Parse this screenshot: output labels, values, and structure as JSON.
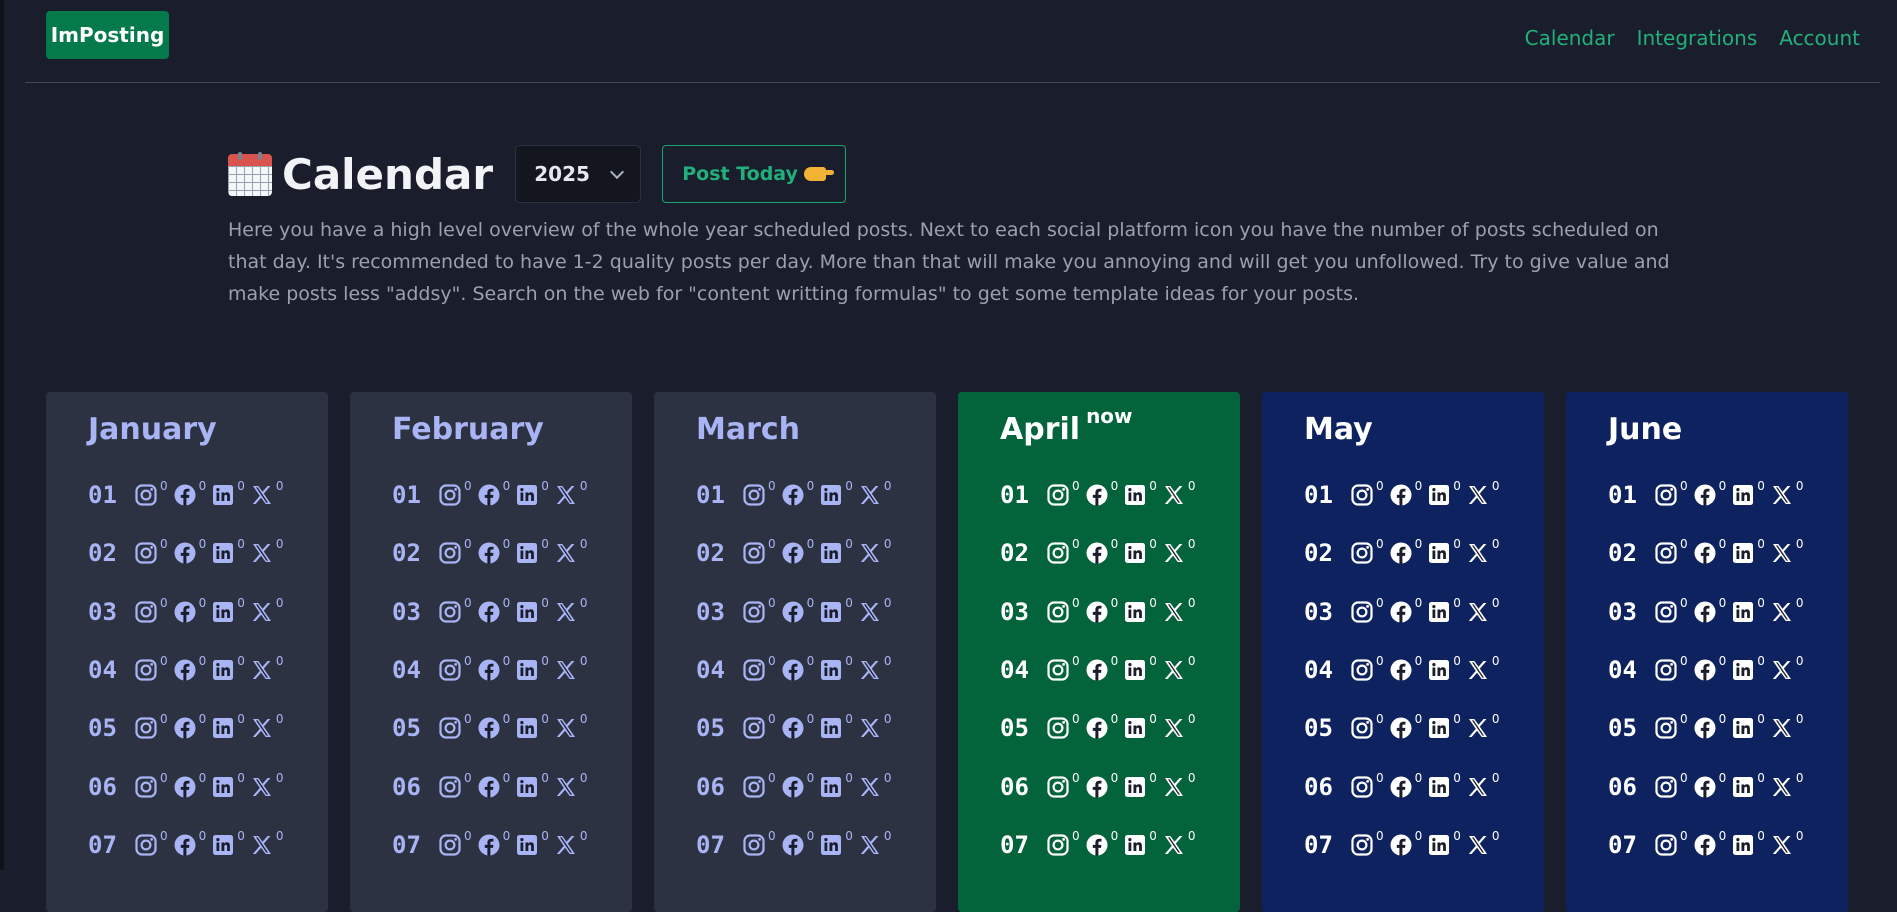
{
  "app": {
    "name": "ImPosting"
  },
  "nav": {
    "calendar": "Calendar",
    "integrations": "Integrations",
    "account": "Account"
  },
  "page": {
    "title": "Calendar",
    "year": "2025",
    "post_today_label": "Post Today",
    "description": "Here you have a high level overview of the whole year scheduled posts. Next to each social platform icon you have the number of posts scheduled on that day. It's recommended to have 1-2 quality posts per day. More than that will make you annoying and will get you unfollowed. Try to give value and make posts less \"addsy\". Search on the web for \"content writting formulas\" to get some template ideas for your posts."
  },
  "colors": {
    "accent": "#22b07a",
    "past_month": "#2d3242",
    "current_month": "#03633b",
    "future_month": "#0e2260"
  },
  "platform_icons": [
    "instagram-icon",
    "facebook-icon",
    "linkedin-icon",
    "x-icon"
  ],
  "months": [
    {
      "name": "January",
      "badge": "",
      "state": "past",
      "days": [
        {
          "num": "01",
          "counts": [
            "0",
            "0",
            "0",
            "0"
          ]
        },
        {
          "num": "02",
          "counts": [
            "0",
            "0",
            "0",
            "0"
          ]
        },
        {
          "num": "03",
          "counts": [
            "0",
            "0",
            "0",
            "0"
          ]
        },
        {
          "num": "04",
          "counts": [
            "0",
            "0",
            "0",
            "0"
          ]
        },
        {
          "num": "05",
          "counts": [
            "0",
            "0",
            "0",
            "0"
          ]
        },
        {
          "num": "06",
          "counts": [
            "0",
            "0",
            "0",
            "0"
          ]
        },
        {
          "num": "07",
          "counts": [
            "0",
            "0",
            "0",
            "0"
          ]
        }
      ]
    },
    {
      "name": "February",
      "badge": "",
      "state": "past",
      "days": [
        {
          "num": "01",
          "counts": [
            "0",
            "0",
            "0",
            "0"
          ]
        },
        {
          "num": "02",
          "counts": [
            "0",
            "0",
            "0",
            "0"
          ]
        },
        {
          "num": "03",
          "counts": [
            "0",
            "0",
            "0",
            "0"
          ]
        },
        {
          "num": "04",
          "counts": [
            "0",
            "0",
            "0",
            "0"
          ]
        },
        {
          "num": "05",
          "counts": [
            "0",
            "0",
            "0",
            "0"
          ]
        },
        {
          "num": "06",
          "counts": [
            "0",
            "0",
            "0",
            "0"
          ]
        },
        {
          "num": "07",
          "counts": [
            "0",
            "0",
            "0",
            "0"
          ]
        }
      ]
    },
    {
      "name": "March",
      "badge": "",
      "state": "past",
      "days": [
        {
          "num": "01",
          "counts": [
            "0",
            "0",
            "0",
            "0"
          ]
        },
        {
          "num": "02",
          "counts": [
            "0",
            "0",
            "0",
            "0"
          ]
        },
        {
          "num": "03",
          "counts": [
            "0",
            "0",
            "0",
            "0"
          ]
        },
        {
          "num": "04",
          "counts": [
            "0",
            "0",
            "0",
            "0"
          ]
        },
        {
          "num": "05",
          "counts": [
            "0",
            "0",
            "0",
            "0"
          ]
        },
        {
          "num": "06",
          "counts": [
            "0",
            "0",
            "0",
            "0"
          ]
        },
        {
          "num": "07",
          "counts": [
            "0",
            "0",
            "0",
            "0"
          ]
        }
      ]
    },
    {
      "name": "April",
      "badge": "now",
      "state": "current",
      "days": [
        {
          "num": "01",
          "counts": [
            "0",
            "0",
            "0",
            "0"
          ]
        },
        {
          "num": "02",
          "counts": [
            "0",
            "0",
            "0",
            "0"
          ]
        },
        {
          "num": "03",
          "counts": [
            "0",
            "0",
            "0",
            "0"
          ]
        },
        {
          "num": "04",
          "counts": [
            "0",
            "0",
            "0",
            "0"
          ]
        },
        {
          "num": "05",
          "counts": [
            "0",
            "0",
            "0",
            "0"
          ]
        },
        {
          "num": "06",
          "counts": [
            "0",
            "0",
            "0",
            "0"
          ]
        },
        {
          "num": "07",
          "counts": [
            "0",
            "0",
            "0",
            "0"
          ]
        }
      ]
    },
    {
      "name": "May",
      "badge": "",
      "state": "future",
      "days": [
        {
          "num": "01",
          "counts": [
            "0",
            "0",
            "0",
            "0"
          ]
        },
        {
          "num": "02",
          "counts": [
            "0",
            "0",
            "0",
            "0"
          ]
        },
        {
          "num": "03",
          "counts": [
            "0",
            "0",
            "0",
            "0"
          ]
        },
        {
          "num": "04",
          "counts": [
            "0",
            "0",
            "0",
            "0"
          ]
        },
        {
          "num": "05",
          "counts": [
            "0",
            "0",
            "0",
            "0"
          ]
        },
        {
          "num": "06",
          "counts": [
            "0",
            "0",
            "0",
            "0"
          ]
        },
        {
          "num": "07",
          "counts": [
            "0",
            "0",
            "0",
            "0"
          ]
        }
      ]
    },
    {
      "name": "June",
      "badge": "",
      "state": "future",
      "days": [
        {
          "num": "01",
          "counts": [
            "0",
            "0",
            "0",
            "0"
          ]
        },
        {
          "num": "02",
          "counts": [
            "0",
            "0",
            "0",
            "0"
          ]
        },
        {
          "num": "03",
          "counts": [
            "0",
            "0",
            "0",
            "0"
          ]
        },
        {
          "num": "04",
          "counts": [
            "0",
            "0",
            "0",
            "0"
          ]
        },
        {
          "num": "05",
          "counts": [
            "0",
            "0",
            "0",
            "0"
          ]
        },
        {
          "num": "06",
          "counts": [
            "0",
            "0",
            "0",
            "0"
          ]
        },
        {
          "num": "07",
          "counts": [
            "0",
            "0",
            "0",
            "0"
          ]
        }
      ]
    }
  ]
}
